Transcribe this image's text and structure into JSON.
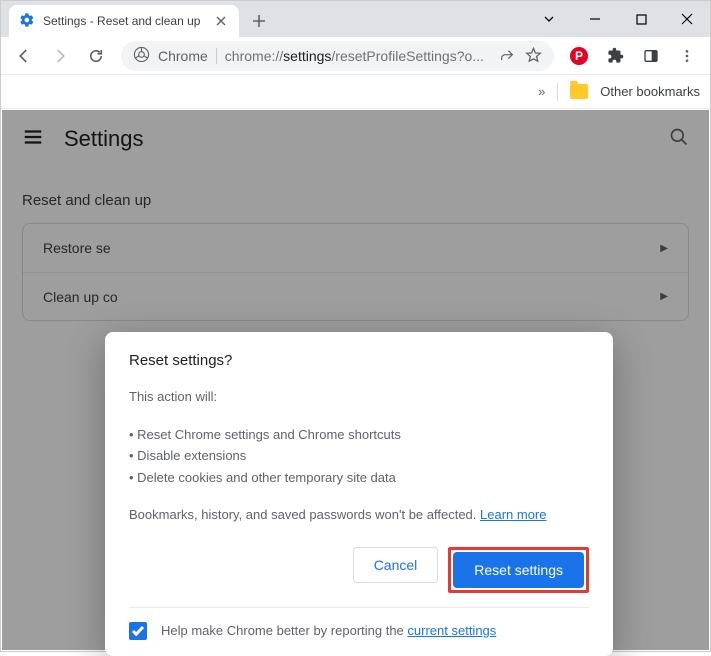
{
  "window": {
    "tab_title": "Settings - Reset and clean up"
  },
  "toolbar": {
    "chrome_label": "Chrome",
    "url_prefix": "chrome://",
    "url_bold": "settings",
    "url_rest": "/resetProfileSettings?o..."
  },
  "bookmarks": {
    "other": "Other bookmarks"
  },
  "settings": {
    "title": "Settings",
    "section": "Reset and clean up",
    "row1": "Restore se",
    "row2": "Clean up co"
  },
  "dialog": {
    "title": "Reset settings?",
    "intro": "This action will:",
    "b1": "• Reset Chrome settings and Chrome shortcuts",
    "b2": "• Disable extensions",
    "b3": "• Delete cookies and other temporary site data",
    "note_a": "Bookmarks, history, and saved passwords won't be affected. ",
    "learn_more": "Learn more",
    "cancel": "Cancel",
    "confirm": "Reset settings",
    "footer_a": "Help make Chrome better by reporting the ",
    "footer_link": "current settings"
  }
}
